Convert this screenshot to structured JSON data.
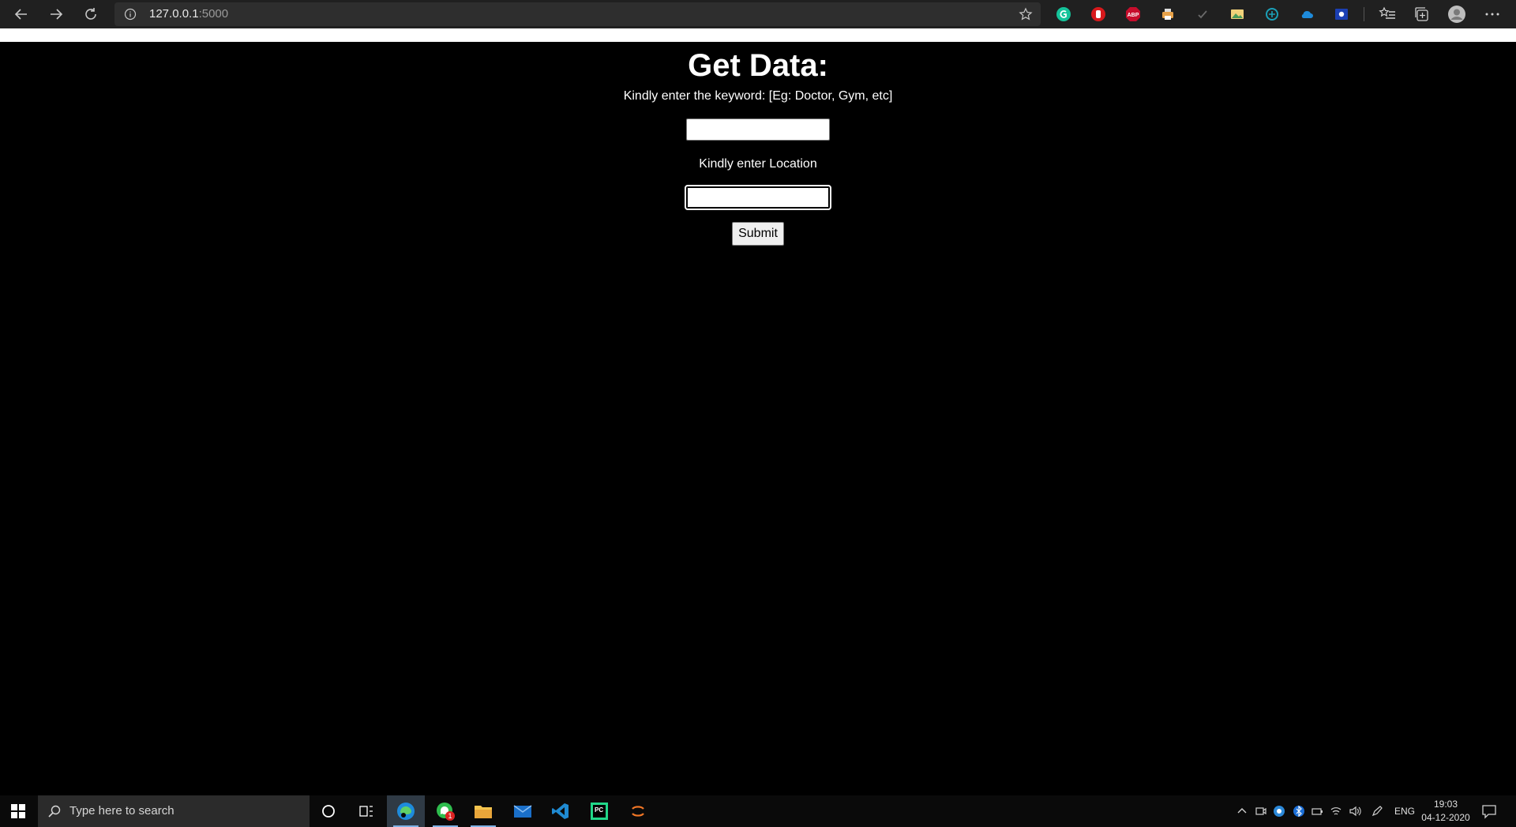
{
  "browser": {
    "url_host": "127.0.0.1",
    "url_port": ":5000",
    "icons": {
      "back": "back-arrow-icon",
      "forward": "forward-arrow-icon",
      "refresh": "refresh-icon",
      "site_info": "info-icon",
      "favorite": "star-icon",
      "extensions": [
        "grammarly-icon",
        "hand-stop-icon",
        "adblock-plus-icon",
        "printer-icon",
        "checkmark-icon",
        "image-icon",
        "puzzle-icon",
        "cloud-icon",
        "photo-id-icon"
      ],
      "favorites_bar": "favorites-icon",
      "collections": "collections-icon",
      "profile": "profile-avatar-icon",
      "menu": "more-menu-icon"
    },
    "adblock_label": "ABP"
  },
  "page": {
    "title": "Get Data:",
    "keyword_label": "Kindly enter the keyword: [Eg: Doctor, Gym, etc]",
    "keyword_value": "",
    "location_label": "Kindly enter Location",
    "location_value": "",
    "submit_label": "Submit"
  },
  "taskbar": {
    "search_placeholder": "Type here to search",
    "apps": [
      "edge-browser-icon",
      "whatsapp-icon",
      "file-explorer-icon",
      "mail-icon",
      "vscode-icon",
      "pycharm-icon",
      "jupyter-icon"
    ],
    "whatsapp_badge": "1",
    "pycharm_label": "PC",
    "language": "ENG",
    "time": "19:03",
    "date": "04-12-2020"
  },
  "colors": {
    "page_background": "#000000",
    "page_text": "#ffffff",
    "chrome_background": "#202020",
    "taskbar_background": "#0a0a0a"
  }
}
